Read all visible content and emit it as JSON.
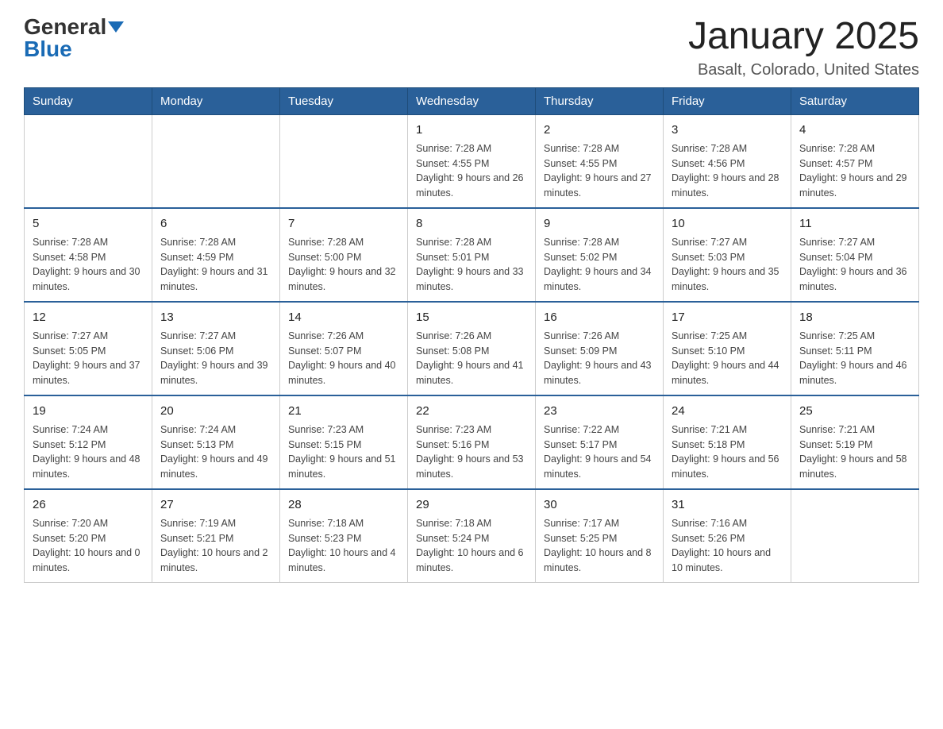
{
  "logo": {
    "general": "General",
    "blue": "Blue"
  },
  "header": {
    "month": "January 2025",
    "location": "Basalt, Colorado, United States"
  },
  "weekdays": [
    "Sunday",
    "Monday",
    "Tuesday",
    "Wednesday",
    "Thursday",
    "Friday",
    "Saturday"
  ],
  "weeks": [
    [
      {
        "day": "",
        "sunrise": "",
        "sunset": "",
        "daylight": ""
      },
      {
        "day": "",
        "sunrise": "",
        "sunset": "",
        "daylight": ""
      },
      {
        "day": "",
        "sunrise": "",
        "sunset": "",
        "daylight": ""
      },
      {
        "day": "1",
        "sunrise": "Sunrise: 7:28 AM",
        "sunset": "Sunset: 4:55 PM",
        "daylight": "Daylight: 9 hours and 26 minutes."
      },
      {
        "day": "2",
        "sunrise": "Sunrise: 7:28 AM",
        "sunset": "Sunset: 4:55 PM",
        "daylight": "Daylight: 9 hours and 27 minutes."
      },
      {
        "day": "3",
        "sunrise": "Sunrise: 7:28 AM",
        "sunset": "Sunset: 4:56 PM",
        "daylight": "Daylight: 9 hours and 28 minutes."
      },
      {
        "day": "4",
        "sunrise": "Sunrise: 7:28 AM",
        "sunset": "Sunset: 4:57 PM",
        "daylight": "Daylight: 9 hours and 29 minutes."
      }
    ],
    [
      {
        "day": "5",
        "sunrise": "Sunrise: 7:28 AM",
        "sunset": "Sunset: 4:58 PM",
        "daylight": "Daylight: 9 hours and 30 minutes."
      },
      {
        "day": "6",
        "sunrise": "Sunrise: 7:28 AM",
        "sunset": "Sunset: 4:59 PM",
        "daylight": "Daylight: 9 hours and 31 minutes."
      },
      {
        "day": "7",
        "sunrise": "Sunrise: 7:28 AM",
        "sunset": "Sunset: 5:00 PM",
        "daylight": "Daylight: 9 hours and 32 minutes."
      },
      {
        "day": "8",
        "sunrise": "Sunrise: 7:28 AM",
        "sunset": "Sunset: 5:01 PM",
        "daylight": "Daylight: 9 hours and 33 minutes."
      },
      {
        "day": "9",
        "sunrise": "Sunrise: 7:28 AM",
        "sunset": "Sunset: 5:02 PM",
        "daylight": "Daylight: 9 hours and 34 minutes."
      },
      {
        "day": "10",
        "sunrise": "Sunrise: 7:27 AM",
        "sunset": "Sunset: 5:03 PM",
        "daylight": "Daylight: 9 hours and 35 minutes."
      },
      {
        "day": "11",
        "sunrise": "Sunrise: 7:27 AM",
        "sunset": "Sunset: 5:04 PM",
        "daylight": "Daylight: 9 hours and 36 minutes."
      }
    ],
    [
      {
        "day": "12",
        "sunrise": "Sunrise: 7:27 AM",
        "sunset": "Sunset: 5:05 PM",
        "daylight": "Daylight: 9 hours and 37 minutes."
      },
      {
        "day": "13",
        "sunrise": "Sunrise: 7:27 AM",
        "sunset": "Sunset: 5:06 PM",
        "daylight": "Daylight: 9 hours and 39 minutes."
      },
      {
        "day": "14",
        "sunrise": "Sunrise: 7:26 AM",
        "sunset": "Sunset: 5:07 PM",
        "daylight": "Daylight: 9 hours and 40 minutes."
      },
      {
        "day": "15",
        "sunrise": "Sunrise: 7:26 AM",
        "sunset": "Sunset: 5:08 PM",
        "daylight": "Daylight: 9 hours and 41 minutes."
      },
      {
        "day": "16",
        "sunrise": "Sunrise: 7:26 AM",
        "sunset": "Sunset: 5:09 PM",
        "daylight": "Daylight: 9 hours and 43 minutes."
      },
      {
        "day": "17",
        "sunrise": "Sunrise: 7:25 AM",
        "sunset": "Sunset: 5:10 PM",
        "daylight": "Daylight: 9 hours and 44 minutes."
      },
      {
        "day": "18",
        "sunrise": "Sunrise: 7:25 AM",
        "sunset": "Sunset: 5:11 PM",
        "daylight": "Daylight: 9 hours and 46 minutes."
      }
    ],
    [
      {
        "day": "19",
        "sunrise": "Sunrise: 7:24 AM",
        "sunset": "Sunset: 5:12 PM",
        "daylight": "Daylight: 9 hours and 48 minutes."
      },
      {
        "day": "20",
        "sunrise": "Sunrise: 7:24 AM",
        "sunset": "Sunset: 5:13 PM",
        "daylight": "Daylight: 9 hours and 49 minutes."
      },
      {
        "day": "21",
        "sunrise": "Sunrise: 7:23 AM",
        "sunset": "Sunset: 5:15 PM",
        "daylight": "Daylight: 9 hours and 51 minutes."
      },
      {
        "day": "22",
        "sunrise": "Sunrise: 7:23 AM",
        "sunset": "Sunset: 5:16 PM",
        "daylight": "Daylight: 9 hours and 53 minutes."
      },
      {
        "day": "23",
        "sunrise": "Sunrise: 7:22 AM",
        "sunset": "Sunset: 5:17 PM",
        "daylight": "Daylight: 9 hours and 54 minutes."
      },
      {
        "day": "24",
        "sunrise": "Sunrise: 7:21 AM",
        "sunset": "Sunset: 5:18 PM",
        "daylight": "Daylight: 9 hours and 56 minutes."
      },
      {
        "day": "25",
        "sunrise": "Sunrise: 7:21 AM",
        "sunset": "Sunset: 5:19 PM",
        "daylight": "Daylight: 9 hours and 58 minutes."
      }
    ],
    [
      {
        "day": "26",
        "sunrise": "Sunrise: 7:20 AM",
        "sunset": "Sunset: 5:20 PM",
        "daylight": "Daylight: 10 hours and 0 minutes."
      },
      {
        "day": "27",
        "sunrise": "Sunrise: 7:19 AM",
        "sunset": "Sunset: 5:21 PM",
        "daylight": "Daylight: 10 hours and 2 minutes."
      },
      {
        "day": "28",
        "sunrise": "Sunrise: 7:18 AM",
        "sunset": "Sunset: 5:23 PM",
        "daylight": "Daylight: 10 hours and 4 minutes."
      },
      {
        "day": "29",
        "sunrise": "Sunrise: 7:18 AM",
        "sunset": "Sunset: 5:24 PM",
        "daylight": "Daylight: 10 hours and 6 minutes."
      },
      {
        "day": "30",
        "sunrise": "Sunrise: 7:17 AM",
        "sunset": "Sunset: 5:25 PM",
        "daylight": "Daylight: 10 hours and 8 minutes."
      },
      {
        "day": "31",
        "sunrise": "Sunrise: 7:16 AM",
        "sunset": "Sunset: 5:26 PM",
        "daylight": "Daylight: 10 hours and 10 minutes."
      },
      {
        "day": "",
        "sunrise": "",
        "sunset": "",
        "daylight": ""
      }
    ]
  ]
}
